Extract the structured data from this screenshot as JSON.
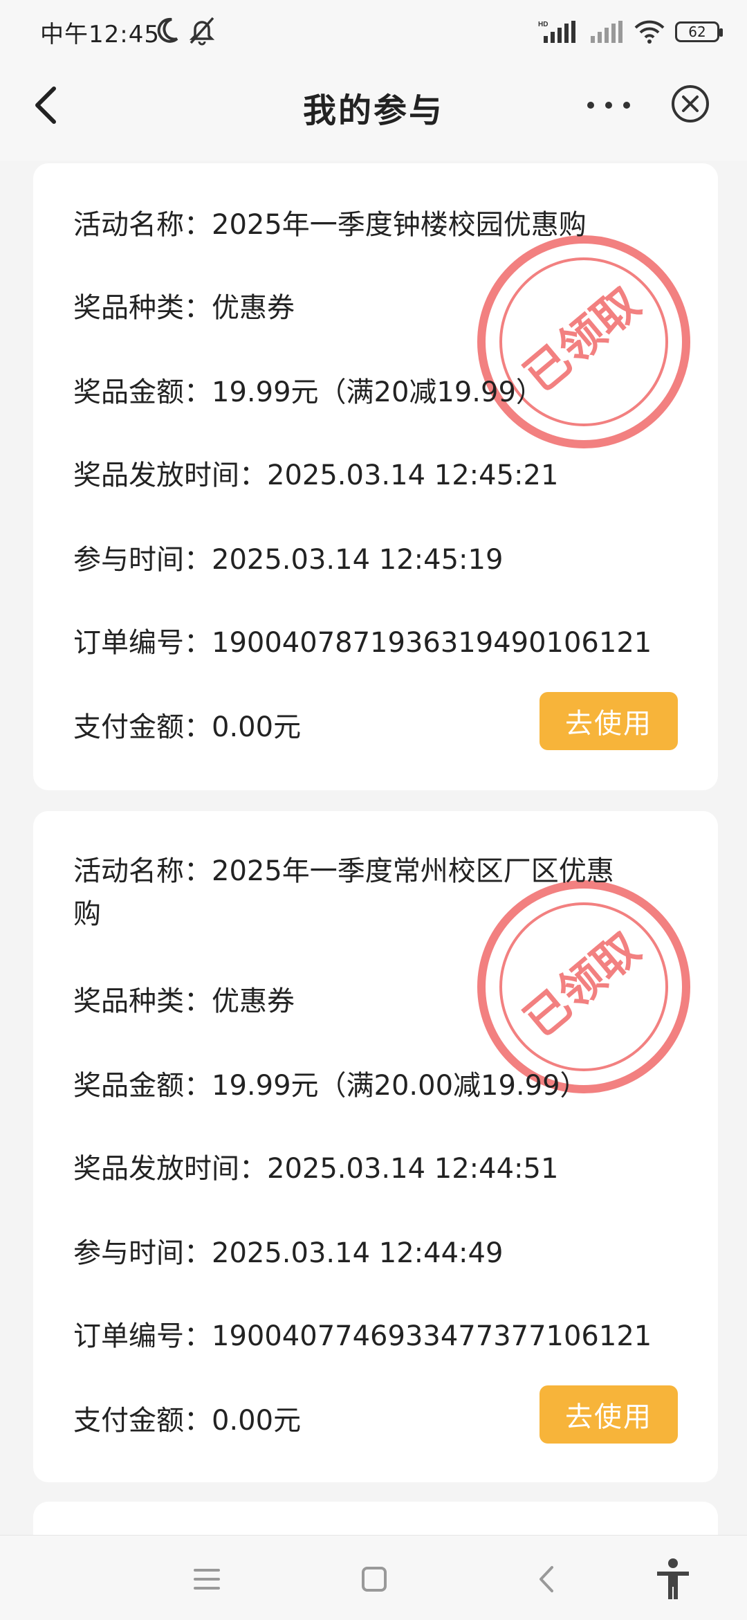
{
  "status_bar": {
    "time": "中午12:45",
    "battery": "62",
    "icons": [
      "moon-icon",
      "bell-off-icon",
      "hd-signal-icon",
      "signal-icon",
      "wifi-icon",
      "battery-icon"
    ]
  },
  "header": {
    "title": "我的参与"
  },
  "labels": {
    "activity": "活动名称：",
    "prize_type": "奖品种类：",
    "prize_amount": "奖品金额：",
    "issue_time": "奖品发放时间：",
    "join_time": "参与时间：",
    "order_no": "订单编号：",
    "pay_amount": "支付金额："
  },
  "cards": [
    {
      "activity_name": "2025年一季度钟楼校园优惠购",
      "prize_type": "优惠券",
      "prize_amount": "19.99元（满20减19.99）",
      "issue_time": "2025.03.14 12:45:21",
      "join_time": "2025.03.14 12:45:19",
      "order_no": "19004078719363194901​06121",
      "pay_amount": "0.00元",
      "button": "去使用",
      "stamp": "已领取"
    },
    {
      "activity_name_line1": "2025年一季度常州校区厂区优惠",
      "activity_name_line2": "购",
      "prize_type": "优惠券",
      "prize_amount": "19.99元（满20.00减19.99）",
      "issue_time": "2025.03.14 12:44:51",
      "join_time": "2025.03.14 12:44:49",
      "order_no": "1900407746933477377106121",
      "pay_amount": "0.00元",
      "button": "去使用",
      "stamp": "已领取"
    }
  ],
  "colors": {
    "accent_button": "#f7b43a",
    "stamp_red": "#f06a6a",
    "background": "#f4f4f4"
  }
}
